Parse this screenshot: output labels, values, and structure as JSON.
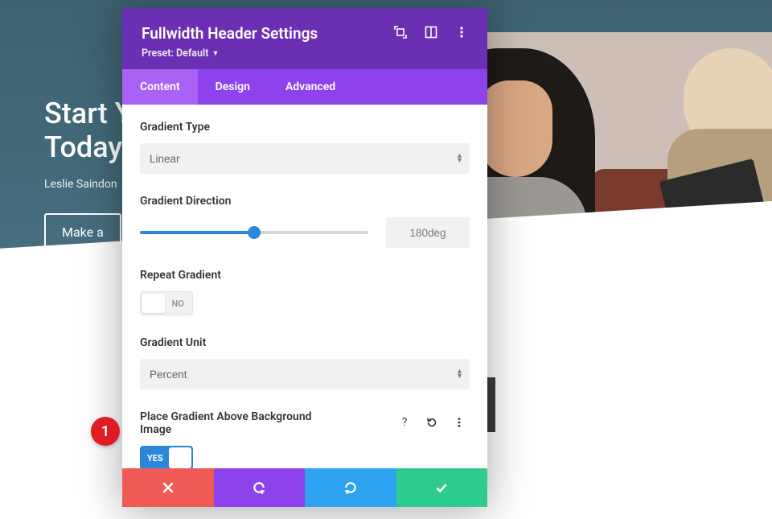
{
  "hero": {
    "title_line1": "Start Y",
    "title_line2": "Today.",
    "subtitle": "Leslie Saindon",
    "cta_label": "Make a"
  },
  "modal": {
    "title": "Fullwidth Header Settings",
    "preset_label": "Preset: Default",
    "tabs": {
      "content": "Content",
      "design": "Design",
      "advanced": "Advanced",
      "active": "content"
    }
  },
  "fields": {
    "gradient_type": {
      "label": "Gradient Type",
      "value": "Linear"
    },
    "gradient_direction": {
      "label": "Gradient Direction",
      "value": "180deg",
      "percent": 50
    },
    "repeat_gradient": {
      "label": "Repeat Gradient",
      "value": false,
      "on_label": "YES",
      "off_label": "NO"
    },
    "gradient_unit": {
      "label": "Gradient Unit",
      "value": "Percent"
    },
    "place_above": {
      "label": "Place Gradient Above Background Image",
      "value": true,
      "on_label": "YES",
      "off_label": "NO"
    }
  },
  "footer": {
    "cancel": "Cancel",
    "undo": "Undo",
    "redo": "Redo",
    "save": "Save"
  },
  "annotation": {
    "n1": "1"
  }
}
